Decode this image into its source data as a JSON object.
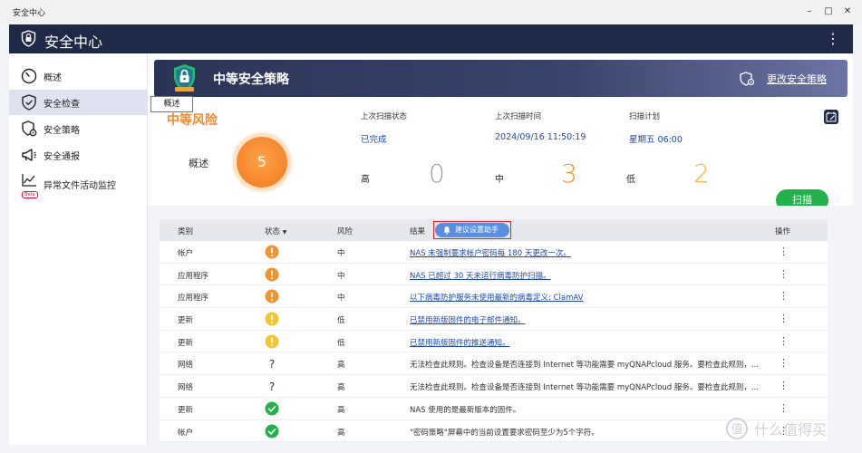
{
  "window": {
    "title": "安全中心"
  },
  "app": {
    "title": "安全中心"
  },
  "sidebar": {
    "items": [
      {
        "label": "概述",
        "icon": "speedometer-icon"
      },
      {
        "label": "安全检查",
        "icon": "shield-check-icon"
      },
      {
        "label": "安全策略",
        "icon": "shield-gear-icon"
      },
      {
        "label": "安全通报",
        "icon": "megaphone-icon"
      },
      {
        "label": "异常文件活动监控",
        "icon": "chart-line-icon",
        "badge": "Beta"
      }
    ]
  },
  "banner": {
    "title": "中等安全策略",
    "link_label": "更改安全策略"
  },
  "tooltip": "概述",
  "summary": {
    "risk_level": "中等风险",
    "overview_label": "概述",
    "score": "5",
    "last_scan_status_label": "上次扫描状态",
    "last_scan_status_value": "已完成",
    "last_scan_time_label": "上次扫描时间",
    "last_scan_time_value": "2024/09/16 11:50:19",
    "schedule_label": "扫描计划",
    "schedule_value": "星期五 06:00",
    "high_label": "高",
    "high_count": "0",
    "medium_label": "中",
    "medium_count": "3",
    "low_label": "低",
    "low_count": "2",
    "scan_button": "扫描"
  },
  "colors": {
    "high": "#9aa0a8",
    "medium": "#f5942f",
    "low": "#f7b63d",
    "scan": "#22b24c",
    "link": "#1f4aa8"
  },
  "table": {
    "headers": {
      "category": "类别",
      "status": "状态",
      "risk": "风险",
      "result": "结果",
      "advice_button": "建议设置助手",
      "action": "操作"
    },
    "rows": [
      {
        "category": "帐户",
        "status": "warning-orange",
        "risk": "中",
        "result": "NAS 未强制要求帐户密码每 180 天更改一次。",
        "link": true
      },
      {
        "category": "应用程序",
        "status": "warning-orange",
        "risk": "中",
        "result": "NAS 已超过 30 天未运行病毒防护扫描。",
        "link": true
      },
      {
        "category": "应用程序",
        "status": "warning-orange",
        "risk": "中",
        "result": "以下病毒防护服务未使用最新的病毒定义: ClamAV",
        "link": true
      },
      {
        "category": "更新",
        "status": "warning-yellow",
        "risk": "低",
        "result": "已禁用新版固件的电子邮件通知。",
        "link": true
      },
      {
        "category": "更新",
        "status": "warning-yellow",
        "risk": "低",
        "result": "已禁用新版固件的推送通知。",
        "link": true
      },
      {
        "category": "网络",
        "status": "unknown",
        "risk": "高",
        "result": "无法检查此规则。检查设备是否连接到 Internet 等功能需要 myQNAPcloud 服务。要检查此规则，...",
        "link": false
      },
      {
        "category": "网络",
        "status": "unknown",
        "risk": "高",
        "result": "无法检查此规则。检查设备是否连接到 Internet 等功能需要 myQNAPcloud 服务。要检查此规则，...",
        "link": false
      },
      {
        "category": "更新",
        "status": "ok",
        "risk": "高",
        "result": "NAS 使用的是最新版本的固件。",
        "link": false
      },
      {
        "category": "帐户",
        "status": "ok",
        "risk": "高",
        "result": "\"密码策略\"屏幕中的当前设置要求密码至少为5个字符。",
        "link": false
      }
    ]
  },
  "watermark": "什么值得买"
}
